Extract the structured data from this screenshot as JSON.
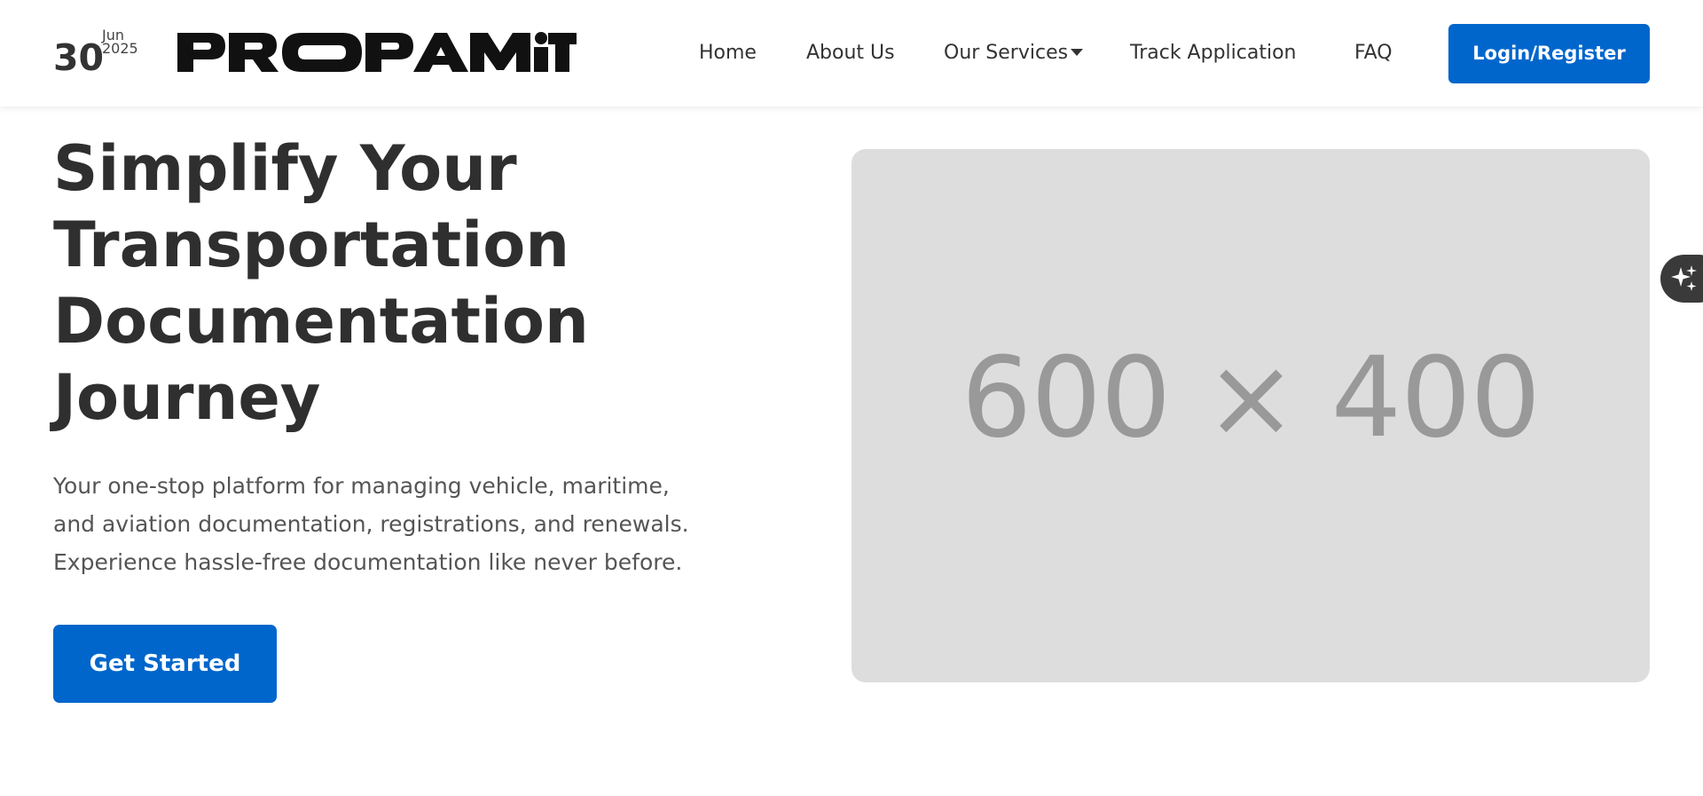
{
  "header": {
    "date": {
      "day": "30",
      "month": "Jun",
      "year": "2025"
    },
    "logo": {
      "text": "PROPAMiT",
      "icon": "propamit-logo"
    },
    "nav": {
      "home": "Home",
      "about": "About Us",
      "services": "Our Services",
      "track": "Track Application",
      "faq": "FAQ"
    },
    "login_label": "Login/Register"
  },
  "hero": {
    "title_lines": [
      "Simplify Your",
      "Transportation",
      "Documentation",
      "Journey"
    ],
    "description_lines": [
      "Your one-stop platform for managing vehicle, maritime,",
      "and aviation documentation, registrations, and renewals.",
      "Experience hassle-free documentation like never before."
    ],
    "cta_label": "Get Started",
    "image_placeholder": "600 × 400"
  },
  "assistant": {
    "icon": "sparkles-icon"
  },
  "colors": {
    "accent": "#0066cc",
    "heading": "#2f2f2f",
    "body_text": "#555555",
    "placeholder_bg": "#dddddd",
    "placeholder_text": "#999999"
  }
}
